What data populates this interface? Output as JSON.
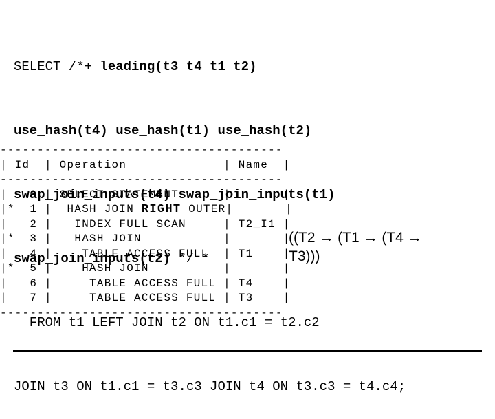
{
  "sql": {
    "lines": [
      {
        "normal_prefix": "SELECT /*+ ",
        "bold": "leading(t3 t4 t1 t2)",
        "normal_suffix": ""
      },
      {
        "normal_prefix": "",
        "bold": "use_hash(t4) use_hash(t1) use_hash(t2)",
        "normal_suffix": ""
      },
      {
        "normal_prefix": "",
        "bold": "swap_join_inputs(t4) swap_join_inputs(t1)",
        "normal_suffix": ""
      },
      {
        "normal_prefix": "",
        "bold": "swap_join_inputs(t2)",
        "normal_suffix": " */ *"
      },
      {
        "normal_prefix": "  FROM t1 LEFT JOIN t2 ON t1.c1 = t2.c2",
        "bold": "",
        "normal_suffix": ""
      },
      {
        "normal_prefix": "JOIN t3 ON t1.c1 = t3.c3 JOIN t4 ON t3.c3 = t4.c4;",
        "bold": "",
        "normal_suffix": ""
      }
    ]
  },
  "plan": {
    "separator": "--------------------------------------",
    "header": {
      "id": "Id",
      "operation": "Operation",
      "name": "Name"
    },
    "rows": [
      {
        "marker": " ",
        "id": "0",
        "indent": "",
        "op_prefix": "SELECT STATEMENT",
        "op_bold": "",
        "op_suffix": "",
        "name": ""
      },
      {
        "marker": "*",
        "id": "1",
        "indent": " ",
        "op_prefix": "HASH JOIN ",
        "op_bold": "RIGHT",
        "op_suffix": " OUTER",
        "name": ""
      },
      {
        "marker": " ",
        "id": "2",
        "indent": "  ",
        "op_prefix": "INDEX FULL SCAN",
        "op_bold": "",
        "op_suffix": "",
        "name": "T2_I1"
      },
      {
        "marker": "*",
        "id": "3",
        "indent": "  ",
        "op_prefix": "HASH JOIN",
        "op_bold": "",
        "op_suffix": "",
        "name": ""
      },
      {
        "marker": " ",
        "id": "4",
        "indent": "   ",
        "op_prefix": "TABLE ACCESS FULL",
        "op_bold": "",
        "op_suffix": "",
        "name": "T1"
      },
      {
        "marker": "*",
        "id": "5",
        "indent": "   ",
        "op_prefix": "HASH JOIN",
        "op_bold": "",
        "op_suffix": "",
        "name": ""
      },
      {
        "marker": " ",
        "id": "6",
        "indent": "    ",
        "op_prefix": "TABLE ACCESS FULL",
        "op_bold": "",
        "op_suffix": "",
        "name": "T4"
      },
      {
        "marker": " ",
        "id": "7",
        "indent": "    ",
        "op_prefix": "TABLE ACCESS FULL",
        "op_bold": "",
        "op_suffix": "",
        "name": "T3"
      }
    ]
  },
  "note": {
    "line1": "((T2 → (T1  → (T4 →",
    "line2": "T3)))"
  }
}
